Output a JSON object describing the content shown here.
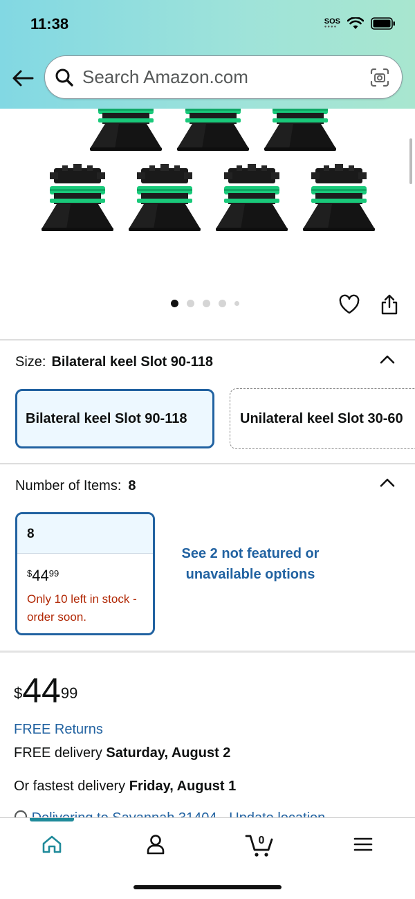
{
  "status_bar": {
    "time": "11:38",
    "sos": "SOS"
  },
  "header": {
    "search_placeholder": "Search Amazon.com"
  },
  "gallery": {
    "dot_count": 5,
    "active_index": 0
  },
  "size": {
    "label": "Size:",
    "selected_value": "Bilateral keel Slot 90-118",
    "options": [
      {
        "label": "Bilateral keel Slot 90-118",
        "selected": true
      },
      {
        "label": "Unilateral keel Slot 30-60",
        "selected": false
      }
    ]
  },
  "items": {
    "label": "Number of Items:",
    "selected_value": "8",
    "card": {
      "count": "8",
      "price_symbol": "$",
      "price_whole": "44",
      "price_fraction": "99",
      "stock": "Only 10 left in stock - order soon."
    },
    "see_more": "See 2 not featured or unavailable options"
  },
  "buy_box": {
    "price_symbol": "$",
    "price_whole": "44",
    "price_fraction": "99",
    "free_returns": "FREE Returns",
    "delivery_prefix": "FREE delivery",
    "delivery_date": "Saturday, August 2",
    "fastest_prefix": "Or fastest delivery",
    "fastest_date": "Friday, August 1",
    "deliver_to": "Delivering to Savannah 31404 - Update location"
  },
  "bottom_nav": {
    "items": [
      "home",
      "account",
      "cart",
      "menu"
    ],
    "cart_count": "0",
    "active": "home"
  },
  "colors": {
    "header_gradient_start": "#82d8e3",
    "header_gradient_end": "#a8e6cf",
    "link": "#2162a1",
    "stock_warning": "#b12704",
    "selected_bg": "#edf8ff",
    "product_accent": "#19c97a"
  }
}
